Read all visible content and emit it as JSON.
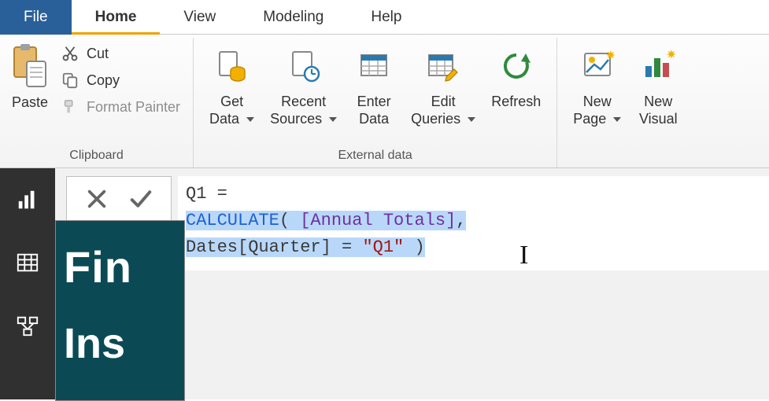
{
  "tabs": {
    "file": "File",
    "home": "Home",
    "view": "View",
    "modeling": "Modeling",
    "help": "Help"
  },
  "ribbon": {
    "clipboard": {
      "label": "Clipboard",
      "paste": "Paste",
      "cut": "Cut",
      "copy": "Copy",
      "format_painter": "Format Painter"
    },
    "external": {
      "label": "External data",
      "get_data": "Get\nData",
      "recent_sources": "Recent\nSources",
      "enter_data": "Enter\nData",
      "edit_queries": "Edit\nQueries",
      "refresh": "Refresh"
    },
    "insert": {
      "new_page": "New\nPage",
      "new_visual": "New\nVisual"
    }
  },
  "formula": {
    "line1_measure": "Q1",
    "line1_rest": " = ",
    "line2_func": "CALCULATE",
    "line2_open": "( ",
    "line2_measure": "[Annual Totals]",
    "line2_close": ",",
    "line3_indent": "    ",
    "line3_col": "Dates[Quarter]",
    "line3_eq": " = ",
    "line3_str": "\"Q1\"",
    "line3_end": " )"
  },
  "thumbnail": {
    "title": "Fin",
    "subtitle": "Ins"
  }
}
